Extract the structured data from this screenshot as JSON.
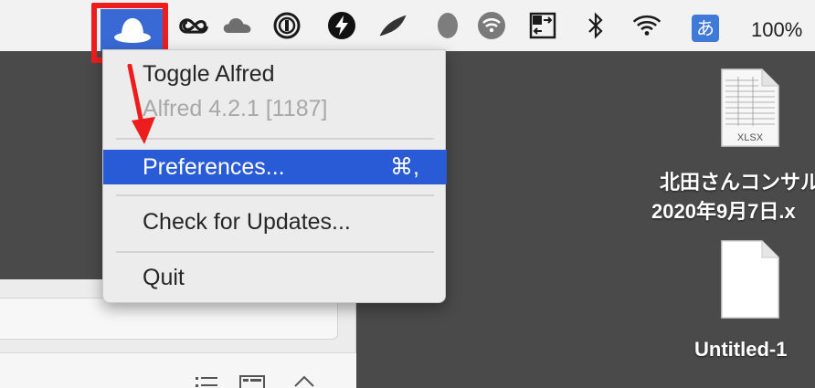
{
  "menubar": {
    "icons": [
      "alfred-hat-icon",
      "creative-cloud-icon",
      "onedrive-icon",
      "1password-icon",
      "reeder-bolt-icon",
      "feather-icon",
      "egg-icon",
      "wifi-hotspot-icon",
      "display-switch-icon",
      "bluetooth-icon",
      "wifi-icon",
      "input-method-icon"
    ],
    "input_method": "あ",
    "battery_percent": "100%",
    "active_color": "#3869d4",
    "highlight_color": "#ee1d1d"
  },
  "menu": {
    "title": "Toggle Alfred",
    "version": "Alfred 4.2.1 [1187]",
    "preferences": "Preferences...",
    "preferences_shortcut": "⌘,",
    "check_updates": "Check for Updates...",
    "quit": "Quit",
    "selected_color": "#2a5bd7"
  },
  "desktop": {
    "files": [
      {
        "name_line1": "北田さんコンサル",
        "name_line2": "2020年9月7日.x",
        "type_badge": "XLSX"
      },
      {
        "name_line1": "Untitled-1"
      }
    ]
  }
}
